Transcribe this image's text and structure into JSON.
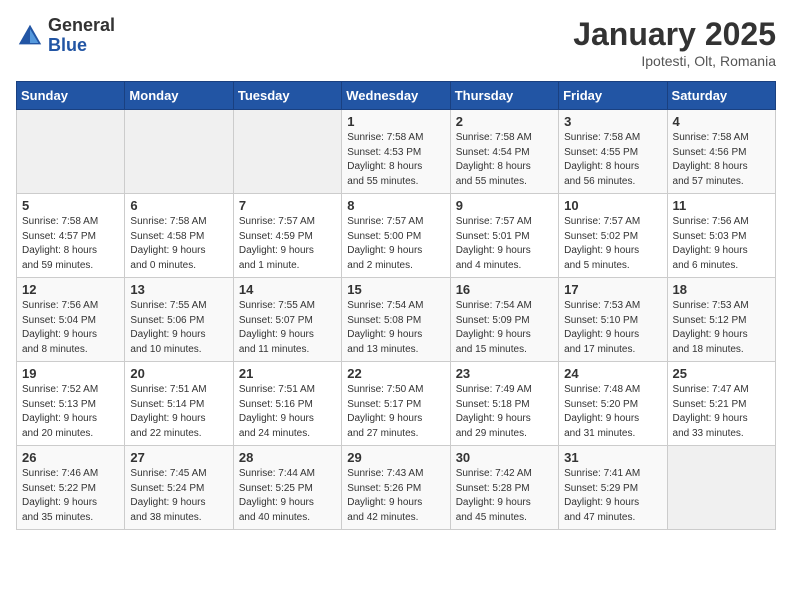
{
  "header": {
    "logo_general": "General",
    "logo_blue": "Blue",
    "month": "January 2025",
    "location": "Ipotesti, Olt, Romania"
  },
  "weekdays": [
    "Sunday",
    "Monday",
    "Tuesday",
    "Wednesday",
    "Thursday",
    "Friday",
    "Saturday"
  ],
  "weeks": [
    [
      {
        "day": "",
        "info": ""
      },
      {
        "day": "",
        "info": ""
      },
      {
        "day": "",
        "info": ""
      },
      {
        "day": "1",
        "info": "Sunrise: 7:58 AM\nSunset: 4:53 PM\nDaylight: 8 hours\nand 55 minutes."
      },
      {
        "day": "2",
        "info": "Sunrise: 7:58 AM\nSunset: 4:54 PM\nDaylight: 8 hours\nand 55 minutes."
      },
      {
        "day": "3",
        "info": "Sunrise: 7:58 AM\nSunset: 4:55 PM\nDaylight: 8 hours\nand 56 minutes."
      },
      {
        "day": "4",
        "info": "Sunrise: 7:58 AM\nSunset: 4:56 PM\nDaylight: 8 hours\nand 57 minutes."
      }
    ],
    [
      {
        "day": "5",
        "info": "Sunrise: 7:58 AM\nSunset: 4:57 PM\nDaylight: 8 hours\nand 59 minutes."
      },
      {
        "day": "6",
        "info": "Sunrise: 7:58 AM\nSunset: 4:58 PM\nDaylight: 9 hours\nand 0 minutes."
      },
      {
        "day": "7",
        "info": "Sunrise: 7:57 AM\nSunset: 4:59 PM\nDaylight: 9 hours\nand 1 minute."
      },
      {
        "day": "8",
        "info": "Sunrise: 7:57 AM\nSunset: 5:00 PM\nDaylight: 9 hours\nand 2 minutes."
      },
      {
        "day": "9",
        "info": "Sunrise: 7:57 AM\nSunset: 5:01 PM\nDaylight: 9 hours\nand 4 minutes."
      },
      {
        "day": "10",
        "info": "Sunrise: 7:57 AM\nSunset: 5:02 PM\nDaylight: 9 hours\nand 5 minutes."
      },
      {
        "day": "11",
        "info": "Sunrise: 7:56 AM\nSunset: 5:03 PM\nDaylight: 9 hours\nand 6 minutes."
      }
    ],
    [
      {
        "day": "12",
        "info": "Sunrise: 7:56 AM\nSunset: 5:04 PM\nDaylight: 9 hours\nand 8 minutes."
      },
      {
        "day": "13",
        "info": "Sunrise: 7:55 AM\nSunset: 5:06 PM\nDaylight: 9 hours\nand 10 minutes."
      },
      {
        "day": "14",
        "info": "Sunrise: 7:55 AM\nSunset: 5:07 PM\nDaylight: 9 hours\nand 11 minutes."
      },
      {
        "day": "15",
        "info": "Sunrise: 7:54 AM\nSunset: 5:08 PM\nDaylight: 9 hours\nand 13 minutes."
      },
      {
        "day": "16",
        "info": "Sunrise: 7:54 AM\nSunset: 5:09 PM\nDaylight: 9 hours\nand 15 minutes."
      },
      {
        "day": "17",
        "info": "Sunrise: 7:53 AM\nSunset: 5:10 PM\nDaylight: 9 hours\nand 17 minutes."
      },
      {
        "day": "18",
        "info": "Sunrise: 7:53 AM\nSunset: 5:12 PM\nDaylight: 9 hours\nand 18 minutes."
      }
    ],
    [
      {
        "day": "19",
        "info": "Sunrise: 7:52 AM\nSunset: 5:13 PM\nDaylight: 9 hours\nand 20 minutes."
      },
      {
        "day": "20",
        "info": "Sunrise: 7:51 AM\nSunset: 5:14 PM\nDaylight: 9 hours\nand 22 minutes."
      },
      {
        "day": "21",
        "info": "Sunrise: 7:51 AM\nSunset: 5:16 PM\nDaylight: 9 hours\nand 24 minutes."
      },
      {
        "day": "22",
        "info": "Sunrise: 7:50 AM\nSunset: 5:17 PM\nDaylight: 9 hours\nand 27 minutes."
      },
      {
        "day": "23",
        "info": "Sunrise: 7:49 AM\nSunset: 5:18 PM\nDaylight: 9 hours\nand 29 minutes."
      },
      {
        "day": "24",
        "info": "Sunrise: 7:48 AM\nSunset: 5:20 PM\nDaylight: 9 hours\nand 31 minutes."
      },
      {
        "day": "25",
        "info": "Sunrise: 7:47 AM\nSunset: 5:21 PM\nDaylight: 9 hours\nand 33 minutes."
      }
    ],
    [
      {
        "day": "26",
        "info": "Sunrise: 7:46 AM\nSunset: 5:22 PM\nDaylight: 9 hours\nand 35 minutes."
      },
      {
        "day": "27",
        "info": "Sunrise: 7:45 AM\nSunset: 5:24 PM\nDaylight: 9 hours\nand 38 minutes."
      },
      {
        "day": "28",
        "info": "Sunrise: 7:44 AM\nSunset: 5:25 PM\nDaylight: 9 hours\nand 40 minutes."
      },
      {
        "day": "29",
        "info": "Sunrise: 7:43 AM\nSunset: 5:26 PM\nDaylight: 9 hours\nand 42 minutes."
      },
      {
        "day": "30",
        "info": "Sunrise: 7:42 AM\nSunset: 5:28 PM\nDaylight: 9 hours\nand 45 minutes."
      },
      {
        "day": "31",
        "info": "Sunrise: 7:41 AM\nSunset: 5:29 PM\nDaylight: 9 hours\nand 47 minutes."
      },
      {
        "day": "",
        "info": ""
      }
    ]
  ]
}
